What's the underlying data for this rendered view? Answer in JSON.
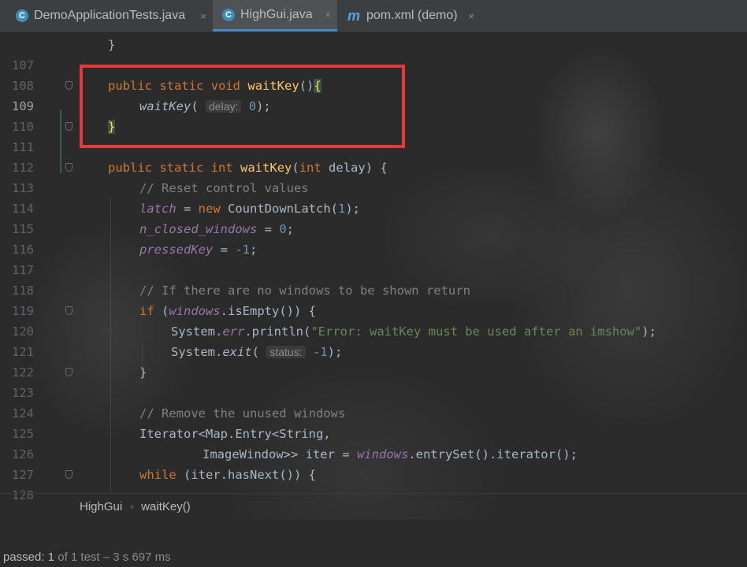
{
  "tabs": [
    {
      "label": "DemoApplicationTests.java",
      "icon": "c-class-icon",
      "icon_text": "C",
      "close": "×"
    },
    {
      "label": "HighGui.java",
      "icon": "c-class-lock-icon",
      "icon_text": "C",
      "close": "×",
      "active": true
    },
    {
      "label": "pom.xml (demo)",
      "icon": "maven-m-icon",
      "icon_text": "m",
      "close": "×"
    }
  ],
  "editor": {
    "lines": [
      {
        "num": "107"
      },
      {
        "num": "108"
      },
      {
        "num": "109"
      },
      {
        "num": "110"
      },
      {
        "num": "111"
      },
      {
        "num": "112"
      },
      {
        "num": "113"
      },
      {
        "num": "114"
      },
      {
        "num": "115"
      },
      {
        "num": "116"
      },
      {
        "num": "117"
      },
      {
        "num": "118"
      },
      {
        "num": "119"
      },
      {
        "num": "120"
      },
      {
        "num": "121"
      },
      {
        "num": "122"
      },
      {
        "num": "123"
      },
      {
        "num": "124"
      },
      {
        "num": "125"
      },
      {
        "num": "126"
      },
      {
        "num": "127"
      },
      {
        "num": "128"
      }
    ],
    "tokens": {
      "l107": "}",
      "l109_public": "public",
      "l109_static": "static",
      "l109_void": "void",
      "l109_name": "waitKey",
      "l109_paren": "()",
      "l109_brace": "{",
      "l110_call": "waitKey",
      "l110_open": "(",
      "l110_hint": "delay:",
      "l110_num": "0",
      "l110_close": ");",
      "l111_brace": "}",
      "l113_public": "public",
      "l113_static": "static",
      "l113_int": "int",
      "l113_name": "waitKey",
      "l113_open": "(",
      "l113_int2": "int",
      "l113_rest": "delay) {",
      "l114_cmt": "// Reset control values",
      "l115_fld": "latch",
      "l115_eq": " = ",
      "l115_new": "new",
      "l115_cls": " CountDownLatch(",
      "l115_num": "1",
      "l115_end": ");",
      "l116_fld": "n_closed_windows",
      "l116_eq": " = ",
      "l116_num": "0",
      "l116_end": ";",
      "l117_fld": "pressedKey",
      "l117_eq": " = ",
      "l117_num": "-1",
      "l117_end": ";",
      "l119_cmt": "// If there are no windows to be shown return",
      "l120_if": "if",
      "l120_open": " (",
      "l120_fld": "windows",
      "l120_rest": ".isEmpty()) {",
      "l121_sys": "System.",
      "l121_err": "err",
      "l121_call": ".println(",
      "l121_str": "\"Error: waitKey must be used after an imshow\"",
      "l121_end": ");",
      "l122_sys": "System.",
      "l122_exit": "exit",
      "l122_open": "(",
      "l122_hint": "status:",
      "l122_num": "-1",
      "l122_end": ");",
      "l123": "}",
      "l125_cmt": "// Remove the unused windows",
      "l126": "Iterator<Map.Entry<String,",
      "l127_a": "ImageWindow>> iter = ",
      "l127_fld": "windows",
      "l127_b": ".entrySet().iterator();",
      "l128_while": "while",
      "l128_rest": " (iter.hasNext()) {"
    }
  },
  "breadcrumb": {
    "class_name": "HighGui",
    "separator": "›",
    "method": "waitKey()"
  },
  "status": {
    "passed_label": "passed:",
    "passed_count": "1",
    "rest": "of 1 test – 3 s 697 ms"
  },
  "colors": {
    "accent": "#4a88c7",
    "highlight_border": "#e8393a",
    "keyword": "#cc7832",
    "function": "#ffc66d",
    "number": "#6897bb",
    "string": "#6a8759",
    "field": "#9876aa"
  }
}
